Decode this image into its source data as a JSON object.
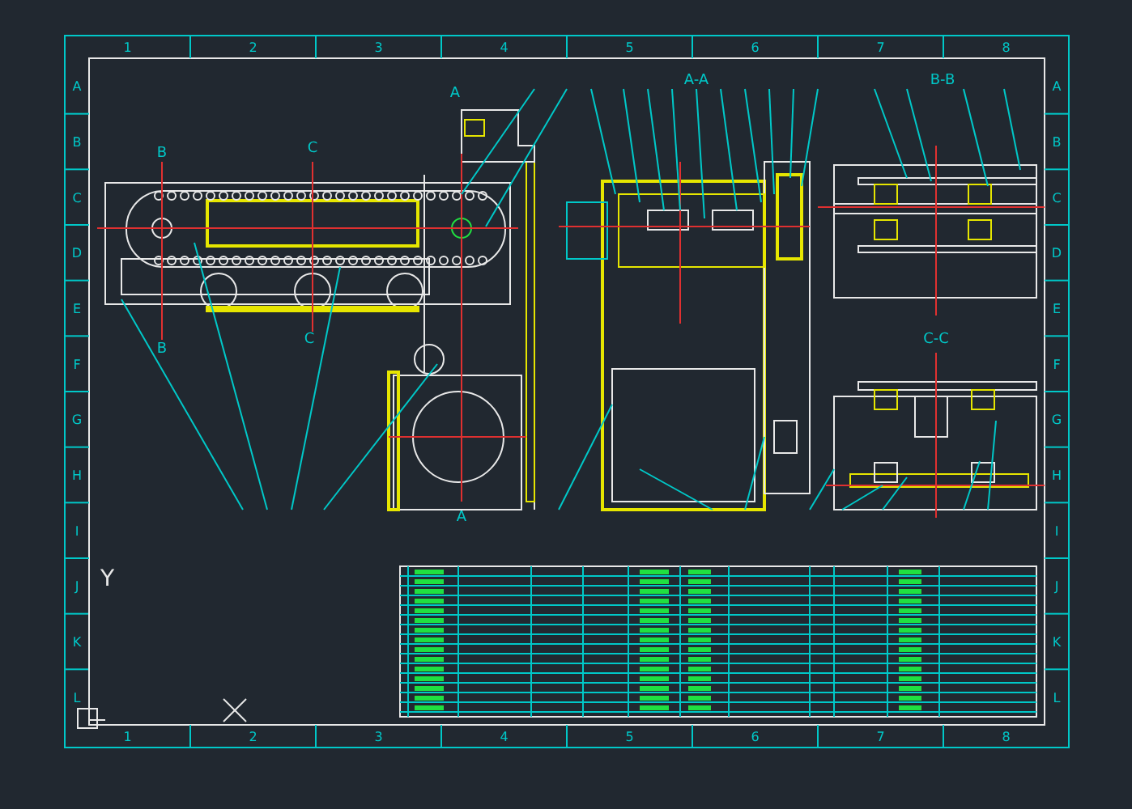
{
  "canvas": {
    "ucs_label": "Y",
    "frame": {
      "top_labels": [
        "1",
        "2",
        "3",
        "4",
        "5",
        "6",
        "7",
        "8"
      ],
      "bottom_labels": [
        "1",
        "2",
        "3",
        "4",
        "5",
        "6",
        "7",
        "8"
      ],
      "left_labels": [
        "A",
        "B",
        "C",
        "D",
        "E",
        "F",
        "G",
        "H",
        "I",
        "J",
        "K",
        "L"
      ],
      "right_labels": [
        "A",
        "B",
        "C",
        "D",
        "E",
        "F",
        "G",
        "H",
        "I",
        "J",
        "K",
        "L"
      ]
    },
    "view_titles": [
      {
        "text": "A-A",
        "kind": "gearbox"
      },
      {
        "text": "B-B",
        "kind": "upper"
      },
      {
        "text": "C-C",
        "kind": "lower"
      }
    ],
    "section_marks": [
      {
        "text": "B",
        "kind": "b-top"
      },
      {
        "text": "B",
        "kind": "b-bottom"
      },
      {
        "text": "C",
        "kind": "c-top"
      },
      {
        "text": "C",
        "kind": "c-bottom"
      },
      {
        "text": "A",
        "kind": "a-top"
      },
      {
        "text": "A",
        "kind": "a-bottom"
      }
    ]
  }
}
